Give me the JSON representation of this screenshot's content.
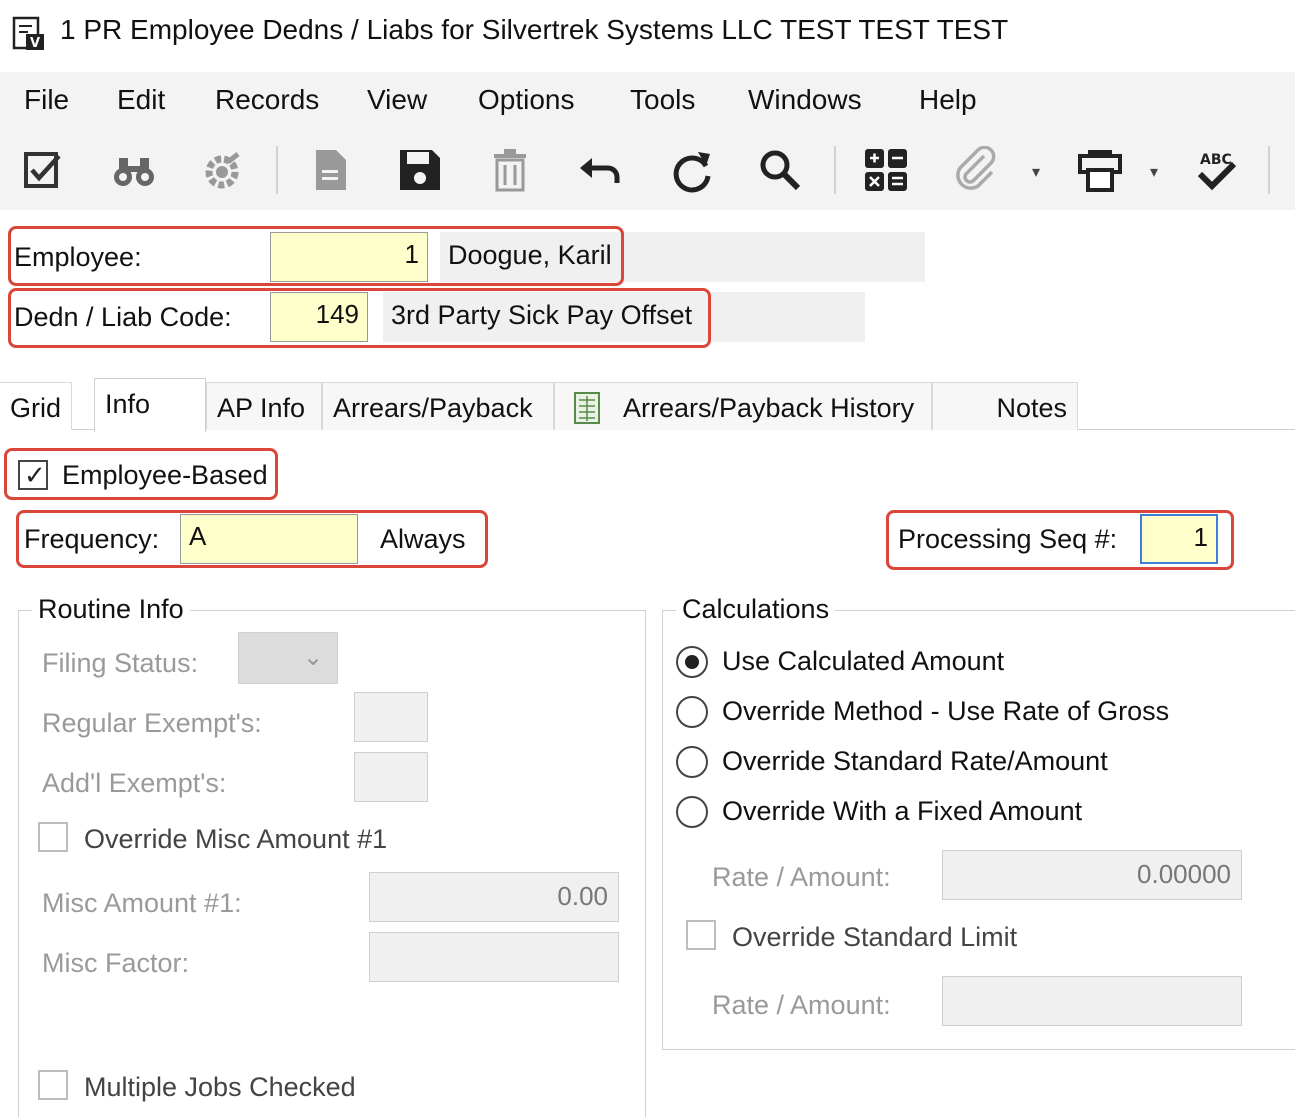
{
  "window": {
    "title": "1 PR Employee Dedns / Liabs for Silvertrek Systems LLC TEST TEST TEST",
    "icon": "app-document-icon"
  },
  "menu": {
    "items": [
      "File",
      "Edit",
      "Records",
      "View",
      "Options",
      "Tools",
      "Windows",
      "Help"
    ]
  },
  "toolbar": {
    "icons": [
      "edit-check-icon",
      "binoculars-icon",
      "gear-icon",
      "new-document-icon",
      "save-icon",
      "delete-icon",
      "undo-icon",
      "refresh-icon",
      "search-icon",
      "calculator-icon",
      "attachment-icon",
      "print-icon",
      "spellcheck-icon"
    ],
    "spellcheck_text": "ABC"
  },
  "header": {
    "employee_label": "Employee:",
    "employee_value": "1",
    "employee_name": "Doogue, Karil",
    "code_label": "Dedn / Liab Code:",
    "code_value": "149",
    "code_name": "3rd Party Sick Pay Offset"
  },
  "tabs": [
    "Grid",
    "Info",
    "AP Info",
    "Arrears/Payback",
    "Arrears/Payback History",
    "Notes"
  ],
  "active_tab": "Info",
  "info": {
    "employee_based_label": "Employee-Based",
    "employee_based_checked": true,
    "frequency_label": "Frequency:",
    "frequency_value": "A",
    "frequency_desc": "Always",
    "processing_seq_label": "Processing Seq #:",
    "processing_seq_value": "1"
  },
  "routine": {
    "title": "Routine Info",
    "filing_status_label": "Filing Status:",
    "regular_exempts_label": "Regular Exempt's:",
    "addl_exempts_label": "Add'l Exempt's:",
    "override_misc_label": "Override Misc Amount #1",
    "misc_amount_label": "Misc Amount #1:",
    "misc_amount_value": "0.00",
    "misc_factor_label": "Misc Factor:",
    "multiple_jobs_label": "Multiple Jobs Checked"
  },
  "calculations": {
    "title": "Calculations",
    "options": [
      "Use Calculated Amount",
      "Override Method - Use Rate of Gross",
      "Override Standard Rate/Amount",
      "Override With a Fixed Amount"
    ],
    "selected_index": 0,
    "rate_amount_label": "Rate / Amount:",
    "rate_amount_value": "0.00000",
    "override_limit_label": "Override Standard Limit",
    "rate_amount2_label": "Rate / Amount:"
  },
  "colors": {
    "highlight": "#d9463a",
    "input_bg": "#ffffcc",
    "focus_border": "#3c7fd6"
  }
}
